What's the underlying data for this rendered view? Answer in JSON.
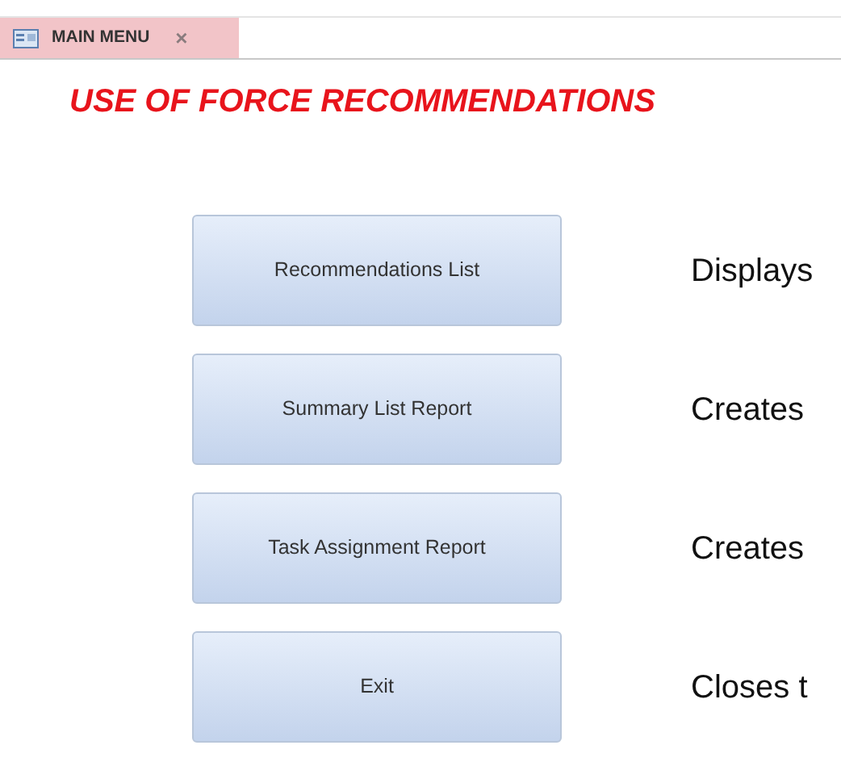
{
  "tab": {
    "label": "MAIN MENU",
    "close": "×",
    "selected": true
  },
  "title": "USE OF FORCE RECOMMENDATIONS",
  "menu": [
    {
      "button": "Recommendations List",
      "description": "Displays"
    },
    {
      "button": "Summary List Report",
      "description": "Creates"
    },
    {
      "button": "Task Assignment Report",
      "description": "Creates"
    },
    {
      "button": "Exit",
      "description": "Closes t"
    }
  ]
}
